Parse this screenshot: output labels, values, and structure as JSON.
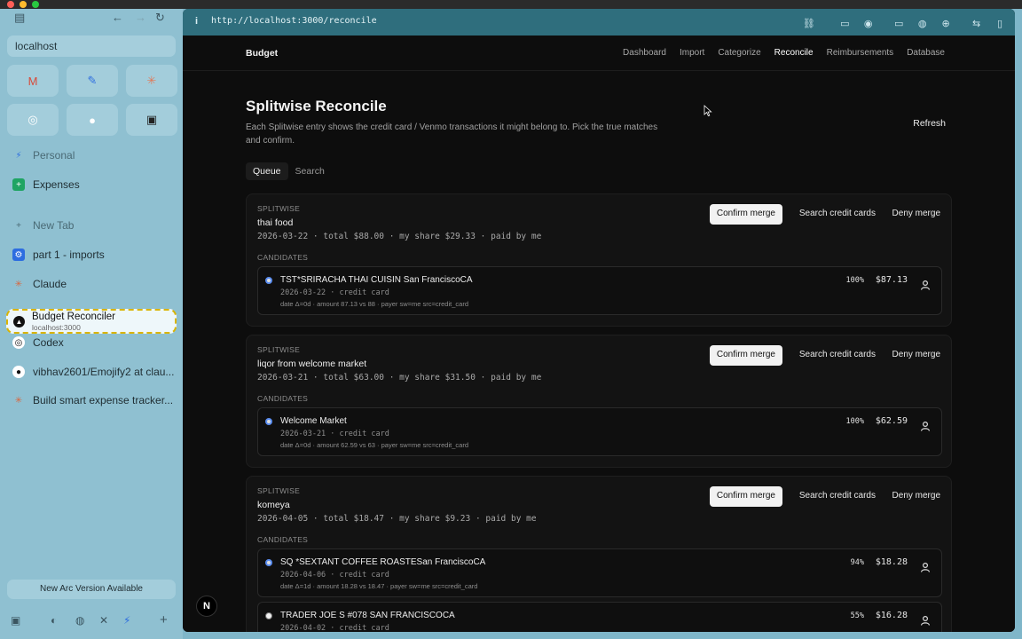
{
  "sidebar": {
    "url": "localhost",
    "favorites": [
      {
        "icon": "gmail-icon",
        "glyph": "M",
        "color": "#d84a3a"
      },
      {
        "icon": "pen-icon",
        "glyph": "✎",
        "color": "#2d6de0"
      },
      {
        "icon": "asterisk-icon",
        "glyph": "✳",
        "color": "#e07a5a"
      },
      {
        "icon": "openai-icon",
        "glyph": "◎",
        "color": "#ffffff"
      },
      {
        "icon": "github-icon",
        "glyph": "●",
        "color": "#ffffff"
      },
      {
        "icon": "grid-icon",
        "glyph": "▣",
        "color": "#222222"
      }
    ],
    "items": [
      {
        "label": "Personal",
        "icon": "bolt-icon",
        "glyph": "⚡",
        "muted": true
      },
      {
        "label": "Expenses",
        "icon": "sheets-icon",
        "glyph": "+",
        "muted": false
      },
      {
        "label": "New Tab",
        "icon": "plus-icon",
        "glyph": "+",
        "muted": true
      },
      {
        "label": "part 1 - imports",
        "icon": "gear-icon",
        "glyph": "⚙",
        "muted": false
      },
      {
        "label": "Claude",
        "icon": "claude-icon",
        "glyph": "✳",
        "muted": false
      },
      {
        "label": "Codex",
        "icon": "codex-icon",
        "glyph": "◎",
        "muted": false
      },
      {
        "label": "vibhav2601/Emojify2 at clau...",
        "icon": "github-icon",
        "glyph": "●",
        "muted": false
      },
      {
        "label": "Build smart expense tracker...",
        "icon": "claude-icon",
        "glyph": "✳",
        "muted": false
      }
    ],
    "active_tab": {
      "title": "Budget Reconciler",
      "subtitle": "localhost:3000"
    },
    "new_version": "New Arc Version Available"
  },
  "address": {
    "url": "http://localhost:3000/reconcile"
  },
  "app": {
    "brand": "Budget",
    "nav": [
      "Dashboard",
      "Import",
      "Categorize",
      "Reconcile",
      "Reimbursements",
      "Database"
    ],
    "active_nav": "Reconcile",
    "title": "Splitwise Reconcile",
    "description": "Each Splitwise entry shows the credit card / Venmo transactions it might belong to. Pick the true matches and confirm.",
    "refresh": "Refresh",
    "tabs": [
      "Queue",
      "Search"
    ],
    "active_tab": "Queue",
    "labels": {
      "kicker": "SPLITWISE",
      "candidates": "CANDIDATES",
      "confirm": "Confirm merge",
      "search": "Search credit cards",
      "deny": "Deny merge"
    },
    "cards": [
      {
        "name": "thai food",
        "meta": "2026-03-22 · total $88.00 · my share $29.33 · paid by me",
        "candidates": [
          {
            "name": "TST*SRIRACHA THAI CUISIN San FranciscoCA",
            "sub": "2026-03-22 · credit card",
            "detail": "date Δ=0d · amount 87.13 vs 88 · payer sw=me src=credit_card",
            "pct": "100%",
            "amount": "$87.13",
            "selected": true
          }
        ]
      },
      {
        "name": "liqor from welcome market",
        "meta": "2026-03-21 · total $63.00 · my share $31.50 · paid by me",
        "candidates": [
          {
            "name": "Welcome Market",
            "sub": "2026-03-21 · credit card",
            "detail": "date Δ=0d · amount 62.59 vs 63 · payer sw=me src=credit_card",
            "pct": "100%",
            "amount": "$62.59",
            "selected": true
          }
        ]
      },
      {
        "name": "komeya",
        "meta": "2026-04-05 · total $18.47 · my share $9.23 · paid by me",
        "candidates": [
          {
            "name": "SQ *SEXTANT COFFEE ROASTESan FranciscoCA",
            "sub": "2026-04-06 · credit card",
            "detail": "date Δ=1d · amount 18.28 vs 18.47 · payer sw=me src=credit_card",
            "pct": "94%",
            "amount": "$18.28",
            "selected": true
          },
          {
            "name": "TRADER JOE S #078 SAN FRANCISCOCA",
            "sub": "2026-04-02 · credit card",
            "detail": "",
            "pct": "55%",
            "amount": "$16.28",
            "selected": false
          }
        ]
      }
    ]
  },
  "badge": "N"
}
